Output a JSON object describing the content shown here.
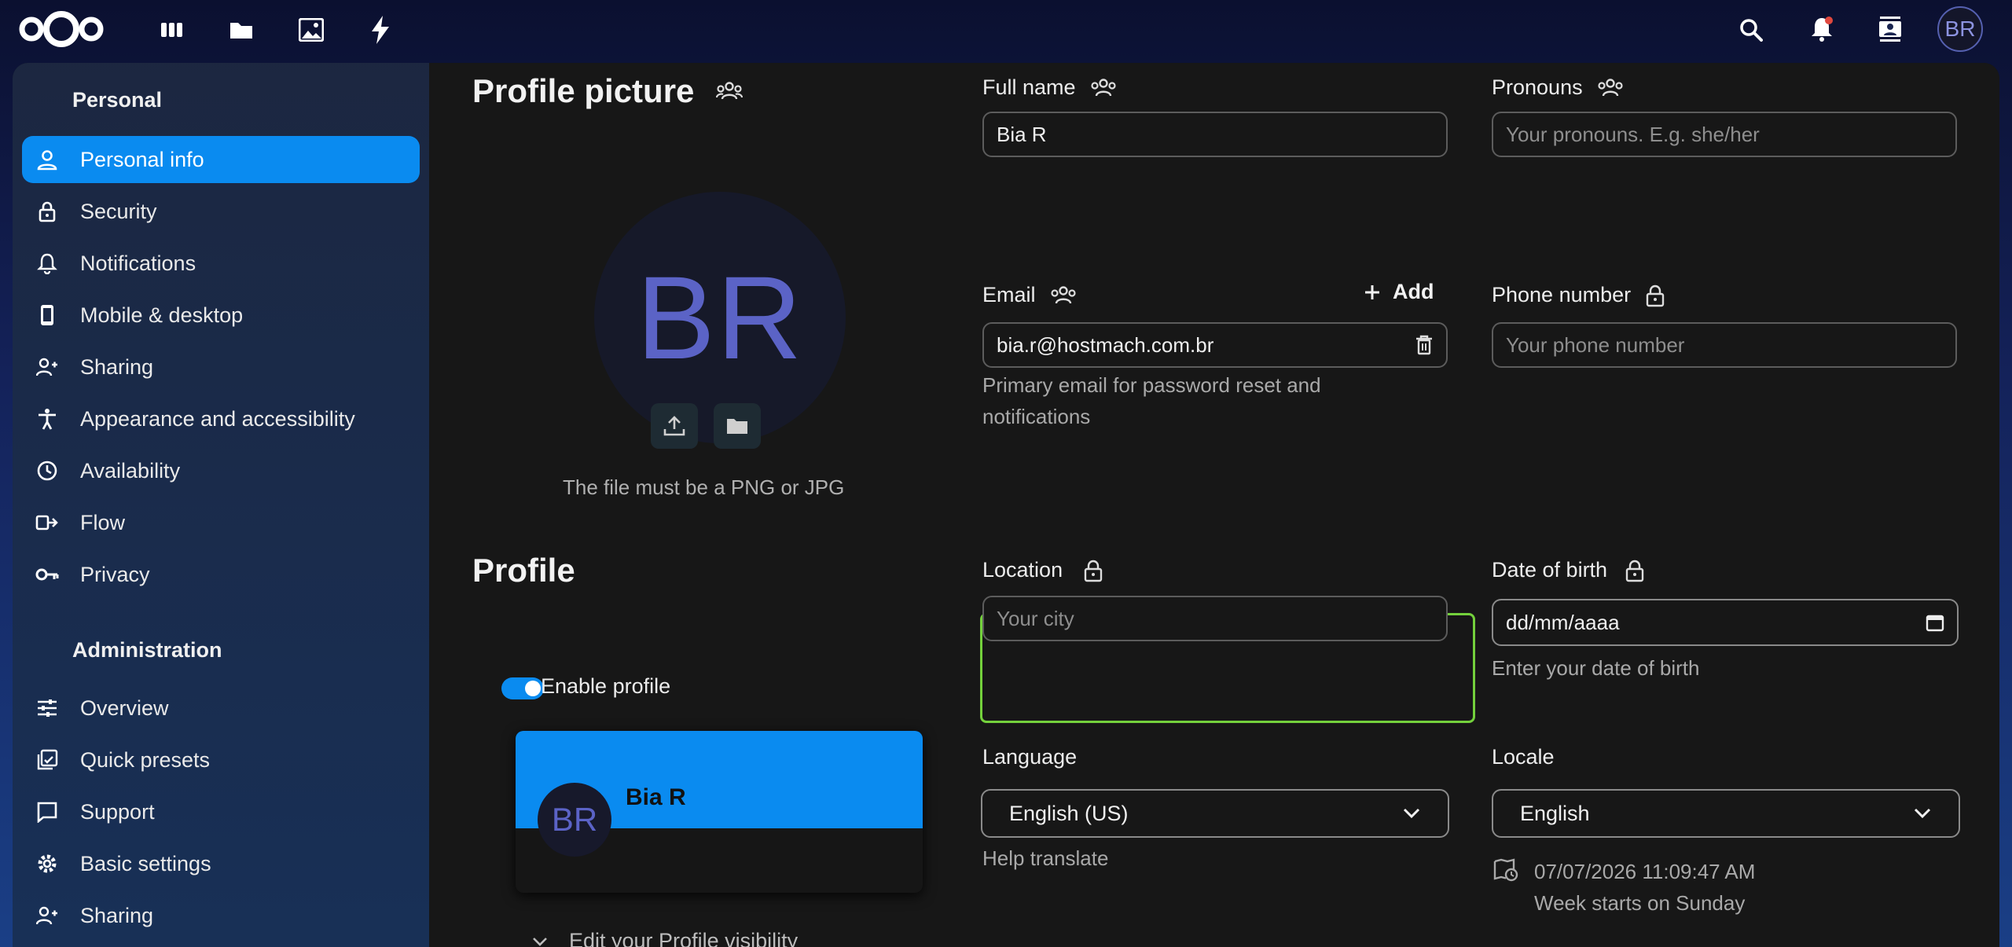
{
  "topbar": {
    "logo_icon": "nextcloud-logo",
    "apps": [
      "dashboard-icon",
      "files-icon",
      "photos-icon",
      "activity-icon"
    ],
    "right_icons": [
      "search-icon",
      "notifications-icon",
      "contacts-icon"
    ],
    "avatar_initials": "BR"
  },
  "sidebar": {
    "personal_caption": "Personal",
    "personal_items": [
      {
        "label": "Personal info",
        "icon": "user-icon",
        "active": true
      },
      {
        "label": "Security",
        "icon": "lock-icon"
      },
      {
        "label": "Notifications",
        "icon": "bell-icon"
      },
      {
        "label": "Mobile & desktop",
        "icon": "phone-icon"
      },
      {
        "label": "Sharing",
        "icon": "share-icon"
      },
      {
        "label": "Appearance and accessibility",
        "icon": "accessibility-icon"
      },
      {
        "label": "Availability",
        "icon": "clock-icon"
      },
      {
        "label": "Flow",
        "icon": "flow-icon"
      },
      {
        "label": "Privacy",
        "icon": "key-icon"
      }
    ],
    "admin_caption": "Administration",
    "admin_items": [
      {
        "label": "Overview",
        "icon": "tune-icon"
      },
      {
        "label": "Quick presets",
        "icon": "presets-icon"
      },
      {
        "label": "Support",
        "icon": "support-icon"
      },
      {
        "label": "Basic settings",
        "icon": "gear-icon"
      },
      {
        "label": "Sharing",
        "icon": "share-icon"
      }
    ]
  },
  "profile_picture": {
    "heading": "Profile picture",
    "initials": "BR",
    "hint": "The file must be a PNG or JPG"
  },
  "profile": {
    "heading": "Profile",
    "enable_label": "Enable profile",
    "card_initials": "BR",
    "card_name": "Bia R",
    "visibility_label": "Edit your Profile visibility"
  },
  "fields": {
    "fullname_label": "Full name",
    "fullname_value": "Bia R",
    "pronouns_label": "Pronouns",
    "pronouns_placeholder": "Your pronouns. E.g. she/her",
    "email_label": "Email",
    "email_add": "Add",
    "email_value": "bia.r@hostmach.com.br",
    "email_hint": "Primary email for password reset and notifications",
    "phone_label": "Phone number",
    "phone_placeholder": "Your phone number",
    "location_label": "Location",
    "location_placeholder": "Your city",
    "dob_label": "Date of birth",
    "dob_value": "dd/mm/aaaa",
    "dob_hint": "Enter your date of birth",
    "language_label": "Language",
    "language_value": "English (US)",
    "language_help": "Help translate",
    "locale_label": "Locale",
    "locale_value": "English",
    "locale_time": "07/07/2026 11:09:47 AM",
    "locale_week": "Week starts on Sunday"
  },
  "colors": {
    "accent": "#0a8bf0",
    "focus": "#74d13c",
    "avatar_text": "#5b63c6"
  }
}
